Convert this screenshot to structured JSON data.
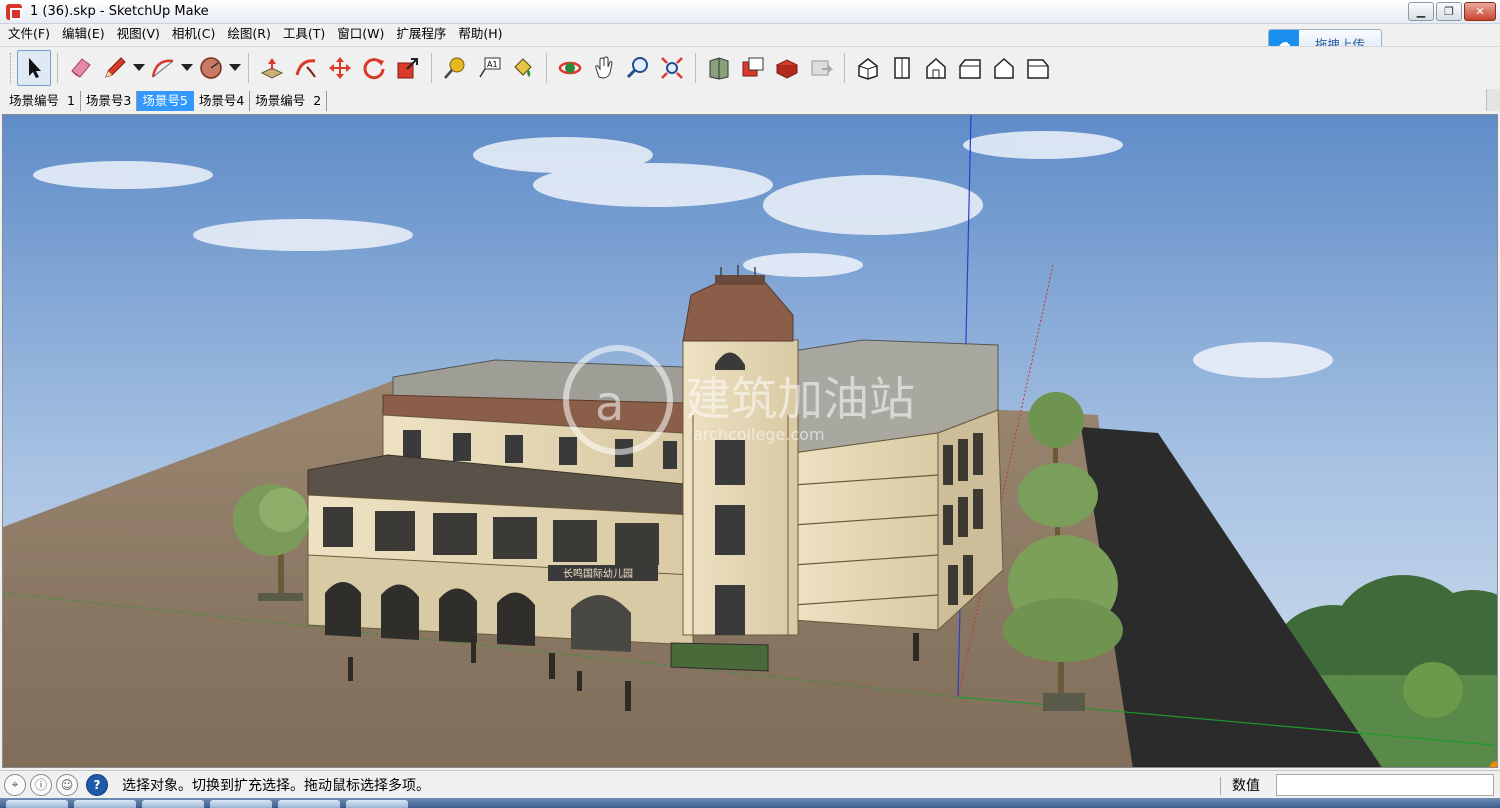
{
  "window": {
    "title": "1 (36).skp - SketchUp Make",
    "controls": [
      "minimize",
      "restore",
      "close"
    ]
  },
  "menu": [
    "文件(F)",
    "编辑(E)",
    "视图(V)",
    "相机(C)",
    "绘图(R)",
    "工具(T)",
    "窗口(W)",
    "扩展程序",
    "帮助(H)"
  ],
  "upload_button": {
    "label": "拖拽上传",
    "icon": "cloud-upload-icon"
  },
  "toolbar": {
    "tools": [
      {
        "name": "select-tool",
        "icon": "arrow-cursor-icon",
        "selected": true
      },
      {
        "name": "eraser-tool",
        "icon": "eraser-icon"
      },
      {
        "name": "line-tool",
        "icon": "pencil-icon",
        "dropdown": true
      },
      {
        "name": "arc-tool",
        "icon": "arc-icon",
        "dropdown": true
      },
      {
        "name": "shape-tool",
        "icon": "polygon-icon",
        "dropdown": true
      },
      {
        "name": "push-pull-tool",
        "icon": "push-pull-icon"
      },
      {
        "name": "follow-me-tool",
        "icon": "follow-me-icon"
      },
      {
        "name": "move-tool",
        "icon": "move-arrows-icon"
      },
      {
        "name": "rotate-tool",
        "icon": "rotate-icon"
      },
      {
        "name": "scale-tool",
        "icon": "scale-icon"
      },
      {
        "name": "tape-measure-tool",
        "icon": "tape-measure-icon"
      },
      {
        "name": "text-tool",
        "icon": "text-label-icon",
        "text": "A1"
      },
      {
        "name": "paint-bucket-tool",
        "icon": "paint-bucket-icon"
      },
      {
        "name": "orbit-tool",
        "icon": "orbit-icon"
      },
      {
        "name": "pan-tool",
        "icon": "hand-icon"
      },
      {
        "name": "zoom-tool",
        "icon": "magnifier-icon"
      },
      {
        "name": "zoom-extents-tool",
        "icon": "zoom-extents-icon"
      },
      {
        "name": "3d-warehouse-tool",
        "icon": "warehouse-icon"
      },
      {
        "name": "extension-warehouse-tool",
        "icon": "extension-icon"
      },
      {
        "name": "share-component-tool",
        "icon": "share-component-icon"
      },
      {
        "name": "get-models-tool",
        "icon": "models-icon"
      },
      {
        "name": "iso-view",
        "icon": "iso-house-icon"
      },
      {
        "name": "top-view",
        "icon": "top-view-icon"
      },
      {
        "name": "front-view",
        "icon": "front-house-icon"
      },
      {
        "name": "right-view",
        "icon": "right-house-icon"
      },
      {
        "name": "back-view",
        "icon": "back-house-icon"
      },
      {
        "name": "left-view",
        "icon": "left-house-icon"
      }
    ]
  },
  "scenes": [
    {
      "label": "场景编号  1",
      "active": false
    },
    {
      "label": "场景号3",
      "active": false
    },
    {
      "label": "场景号5",
      "active": true
    },
    {
      "label": "场景号4",
      "active": false
    },
    {
      "label": "场景编号  2",
      "active": false
    }
  ],
  "viewport": {
    "watermark": "建筑加油站",
    "watermark_sub": "archcollege.com",
    "sign_text": "长鸣国际幼儿园",
    "colors": {
      "sky": "#7ea4d6",
      "ground": "#8b7a66",
      "road": "#2e2e2e",
      "building": "#e6d9b8",
      "roof": "#8b5e4a"
    }
  },
  "statusbar": {
    "icons": [
      "geo-location-icon",
      "info-icon",
      "user-icon"
    ],
    "help_icon": "?",
    "message": "选择对象。切换到扩充选择。拖动鼠标选择多项。",
    "value_label": "数值",
    "value": ""
  }
}
